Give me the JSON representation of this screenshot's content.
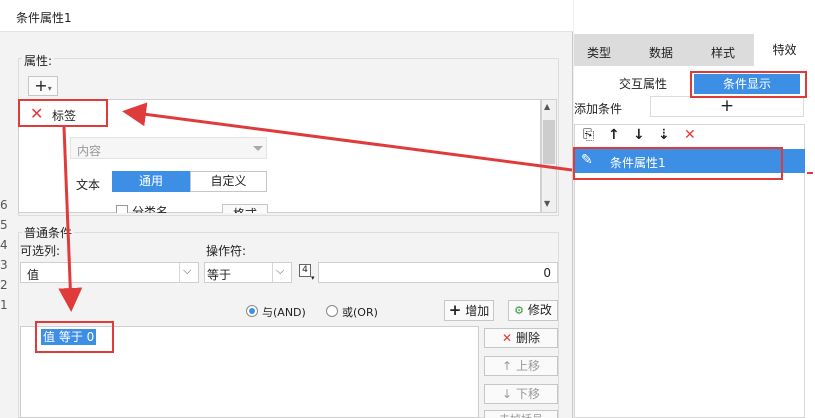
{
  "dialog": {
    "title": "条件属性1"
  },
  "property_section": {
    "legend": "属性:",
    "add_icon": "plus",
    "item_label": "标签",
    "content_select": "内容",
    "text_label": "文本",
    "text_tabs": [
      "通用",
      "自定义"
    ],
    "partial_checkbox_label": "分类名",
    "partial_button": "格式"
  },
  "normal_conditions": {
    "legend": "普通条件",
    "column_label": "可选列:",
    "operator_label": "操作符:",
    "column_value": "值",
    "operator_value": "等于",
    "value_input": "0",
    "radio_and": "与(AND)",
    "radio_or": "或(OR)",
    "add_button": "增加",
    "modify_button": "修改",
    "condition_item": "值 等于 0",
    "delete_button": "删除",
    "move_up_button": "上移",
    "move_down_button": "下移",
    "partial_button": "去掉括号"
  },
  "right_panel": {
    "tabs": [
      "类型",
      "数据",
      "样式",
      "特效"
    ],
    "subtabs": [
      "交互属性",
      "条件显示"
    ],
    "add_condition_label": "添加条件",
    "condition_item": "条件属性1",
    "colors": {
      "accent": "#3d8fe6",
      "annotation": "#e03b3b"
    }
  },
  "left_edge_digits": [
    "6",
    "5",
    "4",
    "3",
    "2",
    "1"
  ]
}
